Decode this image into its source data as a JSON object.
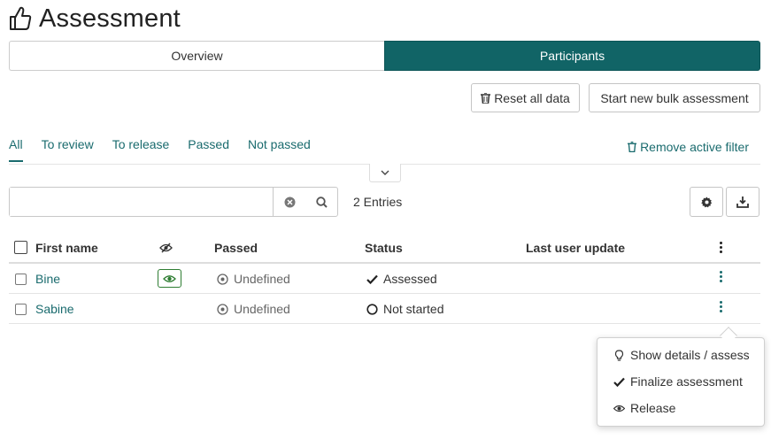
{
  "page": {
    "title": "Assessment"
  },
  "tabs": {
    "overview": "Overview",
    "participants": "Participants"
  },
  "actions": {
    "reset_all": "Reset all data",
    "bulk": "Start new bulk assessment"
  },
  "filters": {
    "all": "All",
    "to_review": "To review",
    "to_release": "To release",
    "passed": "Passed",
    "not_passed": "Not passed",
    "remove": "Remove active filter"
  },
  "search": {
    "value": "",
    "placeholder": ""
  },
  "entries": "2 Entries",
  "table": {
    "headers": {
      "first_name": "First name",
      "passed": "Passed",
      "status": "Status",
      "last_update": "Last user update"
    },
    "rows": [
      {
        "first_name": "Bine",
        "passed": "Undefined",
        "status": "Assessed",
        "last_update": ""
      },
      {
        "first_name": "Sabine",
        "passed": "Undefined",
        "status": "Not started",
        "last_update": ""
      }
    ]
  },
  "menu": {
    "details": "Show details / assess",
    "finalize": "Finalize assessment",
    "release": "Release"
  },
  "colors": {
    "accent": "#116466",
    "link": "#1a6b6e",
    "eye_border": "#2e7d32"
  }
}
